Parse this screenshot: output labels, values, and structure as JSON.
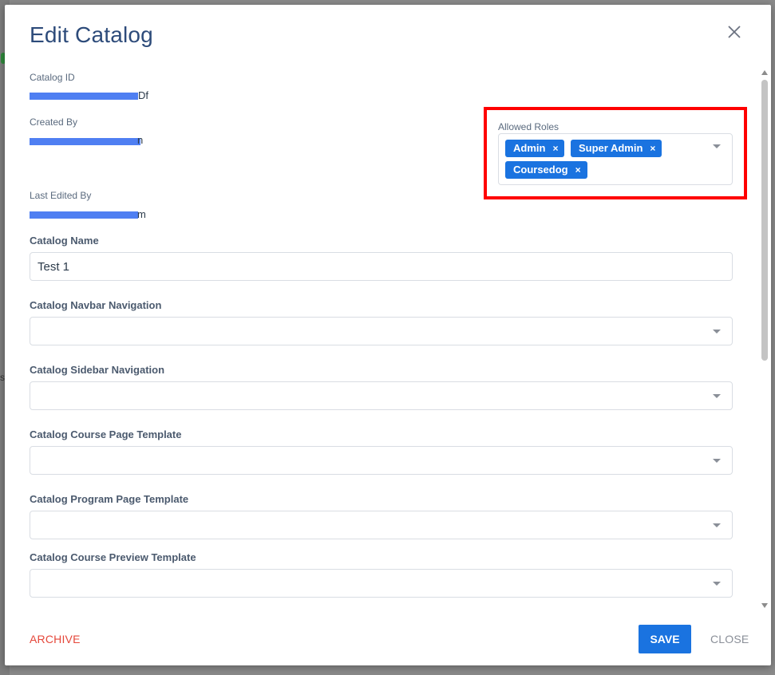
{
  "backdrop": {
    "fragment": "s"
  },
  "modal": {
    "title": "Edit Catalog",
    "close_icon": "close-icon"
  },
  "meta": {
    "catalog_id_label": "Catalog ID",
    "catalog_id_tail": "Df",
    "created_by_label": "Created By",
    "created_by_tail": "n",
    "last_edited_by_label": "Last Edited By",
    "last_edited_by_tail": "m"
  },
  "roles": {
    "label": "Allowed Roles",
    "chips": [
      {
        "label": "Admin",
        "remove": "×"
      },
      {
        "label": "Super Admin",
        "remove": "×"
      },
      {
        "label": "Coursedog",
        "remove": "×"
      }
    ],
    "highlight_color": "#ff0000"
  },
  "fields": {
    "catalog_name_label": "Catalog Name",
    "catalog_name_value": "Test 1",
    "navbar_label": "Catalog Navbar Navigation",
    "sidebar_label": "Catalog Sidebar Navigation",
    "course_page_label": "Catalog Course Page Template",
    "program_page_label": "Catalog Program Page Template",
    "course_preview_label": "Catalog Course Preview Template"
  },
  "footer": {
    "archive_label": "ARCHIVE",
    "save_label": "SAVE",
    "close_label": "CLOSE"
  },
  "colors": {
    "accent": "#1a73e0",
    "title": "#2d4b7a",
    "danger": "#e5473a"
  }
}
